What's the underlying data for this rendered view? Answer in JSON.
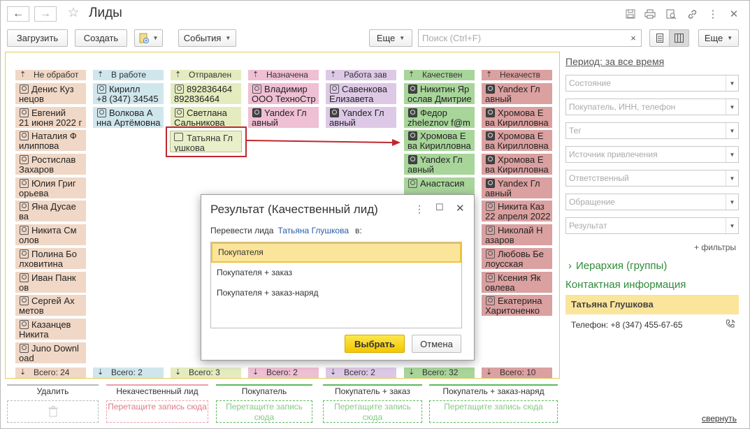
{
  "window": {
    "title": "Лиды"
  },
  "toolbar": {
    "load": "Загрузить",
    "create": "Создать",
    "events": "События",
    "more": "Еще",
    "search_placeholder": "Поиск (Ctrl+F)",
    "search_clear": "×",
    "more_right": "Еще"
  },
  "board": {
    "columns": [
      {
        "header": "Не обработ",
        "bg": "#f0d7c6",
        "total": "Всего: 24",
        "cards": [
          {
            "l1": "Денис Куз",
            "l2": "нецов"
          },
          {
            "l1": "Евгений",
            "l2": "21 июня 2022 г"
          },
          {
            "l1": "Наталия Ф",
            "l2": "илиппова"
          },
          {
            "l1": "Ростислав",
            "l2": "Захаров"
          },
          {
            "l1": "Юлия Григ",
            "l2": "орьева"
          },
          {
            "l1": "Яна Дусае",
            "l2": "ва"
          },
          {
            "l1": "Никита См",
            "l2": "олов"
          },
          {
            "l1": "Полина Бо",
            "l2": "лховитина"
          },
          {
            "l1": "Иван Панк",
            "l2": "ов"
          },
          {
            "l1": "Сергей Ах",
            "l2": "метов"
          },
          {
            "l1": "Казанцев",
            "l2": "Никита"
          },
          {
            "l1": "Juno Downl",
            "l2": "oad"
          }
        ]
      },
      {
        "header": "В работе",
        "bg": "#cfe6ec",
        "total": "Всего: 2",
        "cards": [
          {
            "l1": "Кирилл",
            "l2": "+8 (347) 34545"
          },
          {
            "l1": "Волкова А",
            "l2": "нна Артёмовна"
          }
        ]
      },
      {
        "header": "Отправлен",
        "bg": "#e4ecbf",
        "total": "Всего: 3",
        "cards": [
          {
            "l1": "892836464",
            "l2": "892836464"
          },
          {
            "l1": "Светлана",
            "l2": "Сальникова"
          }
        ]
      },
      {
        "header": "Назначена",
        "bg": "#efbfd3",
        "total": "Всего: 2",
        "cards": [
          {
            "l1": "Владимир",
            "l2": "ООО ТехноСтр"
          },
          {
            "l1": "Yandex Гл",
            "l2": "авный",
            "dark": true
          }
        ]
      },
      {
        "header": "Работа зав",
        "bg": "#ddc9e6",
        "total": "Всего: 2",
        "cards": [
          {
            "l1": "Савенкова",
            "l2": "Елизавета"
          },
          {
            "l1": "Yandex Гл",
            "l2": "авный",
            "dark": true
          }
        ]
      },
      {
        "header": "Качествен",
        "bg": "#a8d59a",
        "total": "Всего: 32",
        "cards": [
          {
            "l1": "Никитин Яр",
            "l2": "ослав Дмитрие",
            "dark": true
          },
          {
            "l1": "Федор",
            "l2": "zheleznov f@m",
            "dark": true
          },
          {
            "l1": "Хромова Е",
            "l2": "ва Кирилловна",
            "dark": true
          },
          {
            "l1": "Yandex Гл",
            "l2": "авный",
            "dark": true
          },
          {
            "l1": "Анастасия",
            "l2": ""
          }
        ]
      },
      {
        "header": "Некачеств",
        "bg": "#dba0a0",
        "total": "Всего: 10",
        "cards": [
          {
            "l1": "Yandex Гл",
            "l2": "авный",
            "dark": true
          },
          {
            "l1": "Хромова Е",
            "l2": "ва Кирилловна",
            "dark": true
          },
          {
            "l1": "Хромова Е",
            "l2": "ва Кирилловна",
            "dark": true
          },
          {
            "l1": "Хромова Е",
            "l2": "ва Кирилловна",
            "dark": true
          },
          {
            "l1": "Yandex Гл",
            "l2": "авный",
            "dark": true
          },
          {
            "l1": "Никита Каз",
            "l2": "22 апреля 2022"
          },
          {
            "l1": "Николай Н",
            "l2": "азаров"
          },
          {
            "l1": "Любовь Бе",
            "l2": "лоусская"
          },
          {
            "l1": "Ксения Як",
            "l2": "овлева"
          },
          {
            "l1": "Екатерина",
            "l2": "Харитоненко"
          }
        ]
      }
    ],
    "dragged": {
      "l1": "Татьяна Гл",
      "l2": "ушкова"
    }
  },
  "right": {
    "period": "Период: за все время",
    "filters": [
      "Состояние",
      "Покупатель, ИНН, телефон",
      "Тег",
      "Источник привлечения",
      "Ответственный",
      "Обращение",
      "Результат"
    ],
    "more_filters": "+ фильтры",
    "hierarchy": "Иерархия (группы)",
    "contact_title": "Контактная информация",
    "contact_name": "Татьяна Глушкова",
    "phone": "Телефон: +8 (347) 455-67-65"
  },
  "zones": [
    {
      "label": "Удалить",
      "drop": "",
      "color": "#b9b9b9",
      "text": "#bbb"
    },
    {
      "label": "Некачественный лид",
      "drop": "Перетащите запись сюда",
      "color": "#e8a0a8",
      "text": "#e07a86"
    },
    {
      "label": "Покупатель",
      "drop": "Перетащите запись сюда",
      "color": "#5cb85c",
      "text": "#85c985"
    },
    {
      "label": "Покупатель + заказ",
      "drop": "Перетащите запись сюда",
      "color": "#5cb85c",
      "text": "#85c985"
    },
    {
      "label": "Покупатель + заказ-наряд",
      "drop": "Перетащите запись сюда",
      "color": "#5cb85c",
      "text": "#85c985"
    }
  ],
  "collapse": "свернуть",
  "dialog": {
    "title": "Результат (Качественный лид)",
    "convert_label": "Перевести лида",
    "lead_name": "Татьяна Глушкова",
    "into": "в:",
    "options": [
      "Покупателя",
      "Покупателя + заказ",
      "Покупателя + заказ-наряд"
    ],
    "ok": "Выбрать",
    "cancel": "Отмена"
  }
}
